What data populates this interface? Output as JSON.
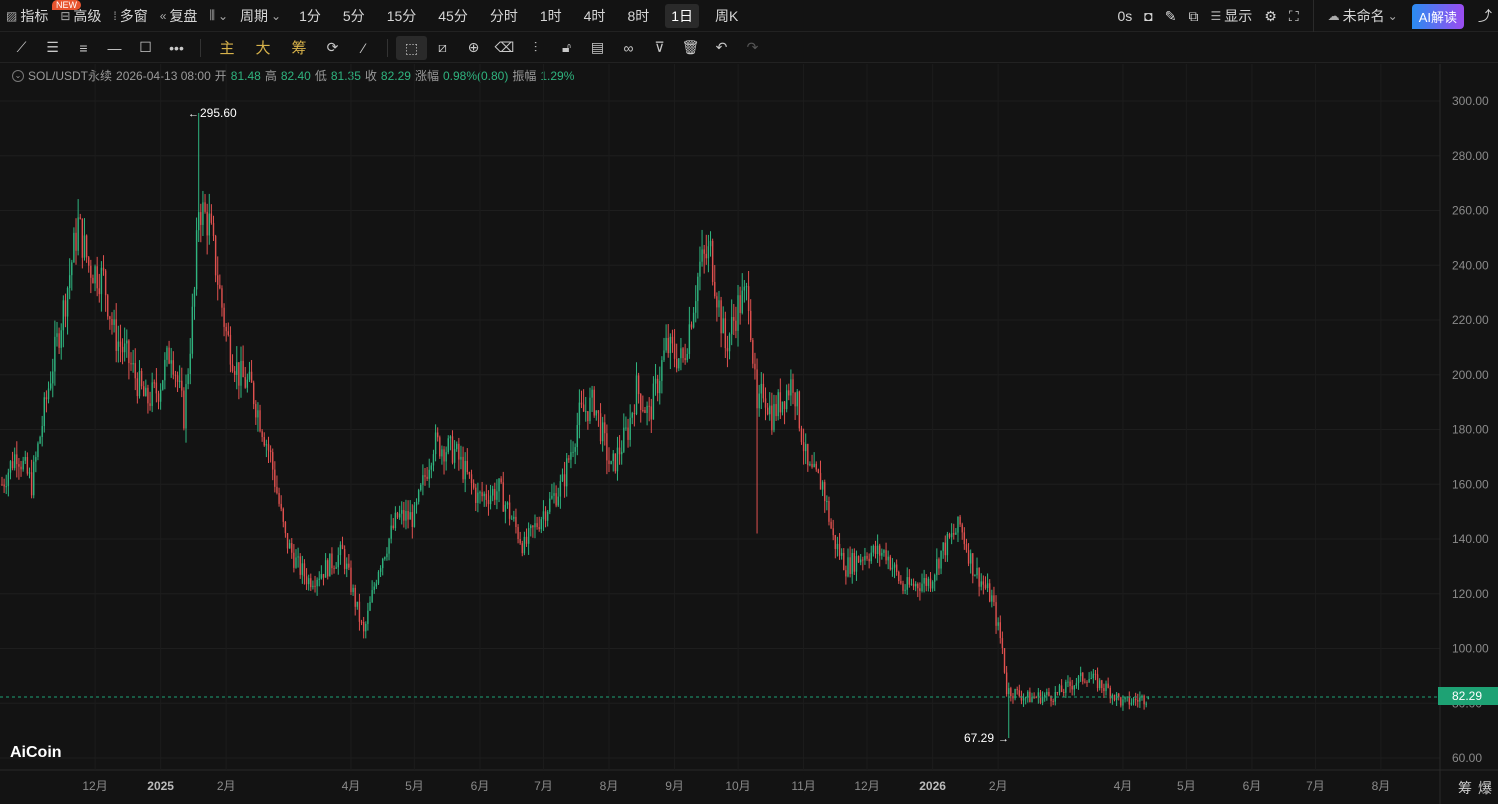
{
  "topbar": {
    "indicators": "指标",
    "new_badge": "NEW",
    "advanced": "高级",
    "multi": "多窗",
    "replay": "复盘",
    "period": "周期",
    "intervals": [
      "1分",
      "5分",
      "15分",
      "45分",
      "分时",
      "1时",
      "4时",
      "8时",
      "1日",
      "周K"
    ],
    "selected_interval": "1日",
    "countdown": "0s",
    "display": "显示",
    "layout_name": "未命名",
    "ai": "AI解读"
  },
  "toolbar": {
    "main": "主",
    "big": "大",
    "chips": "筹"
  },
  "info": {
    "symbol": "SOL/USDT永续",
    "datetime": "2026-04-13 08:00",
    "open_label": "开",
    "open": "81.48",
    "high_label": "高",
    "high": "82.40",
    "low_label": "低",
    "low": "81.35",
    "close_label": "收",
    "close": "82.29",
    "change_label": "涨幅",
    "change": "0.98%(0.80)",
    "amp_label": "振幅",
    "amp": "1.29%"
  },
  "colors": {
    "up": "#2fb47f",
    "down": "#e0514f",
    "bg": "#131313"
  },
  "logo": "AiCoin",
  "bottom": {
    "chips": "筹",
    "liq": "爆"
  },
  "chart_data": {
    "type": "candlestick",
    "symbol": "SOL/USDT",
    "interval": "1d",
    "ylim": [
      60,
      300
    ],
    "yticks": [
      "300.00",
      "280.00",
      "260.00",
      "240.00",
      "220.00",
      "200.00",
      "180.00",
      "160.00",
      "140.00",
      "120.00",
      "100.00",
      "80.00",
      "60.00"
    ],
    "xticks": [
      {
        "label": "12月",
        "date": "2024-12-01"
      },
      {
        "label": "2025",
        "date": "2025-01-01"
      },
      {
        "label": "2月",
        "date": "2025-02-01"
      },
      {
        "label": "4月",
        "date": "2025-04-01"
      },
      {
        "label": "5月",
        "date": "2025-05-01"
      },
      {
        "label": "6月",
        "date": "2025-06-01"
      },
      {
        "label": "7月",
        "date": "2025-07-01"
      },
      {
        "label": "8月",
        "date": "2025-08-01"
      },
      {
        "label": "9月",
        "date": "2025-09-01"
      },
      {
        "label": "10月",
        "date": "2025-10-01"
      },
      {
        "label": "11月",
        "date": "2025-11-01"
      },
      {
        "label": "12月",
        "date": "2025-12-01"
      },
      {
        "label": "2026",
        "date": "2026-01-01"
      },
      {
        "label": "2月",
        "date": "2026-02-01"
      },
      {
        "label": "4月",
        "date": "2026-04-01"
      },
      {
        "label": "5月",
        "date": "2026-05-01"
      },
      {
        "label": "6月",
        "date": "2026-06-01"
      },
      {
        "label": "7月",
        "date": "2026-07-01"
      },
      {
        "label": "8月",
        "date": "2026-08-01"
      }
    ],
    "max_label": "295.60",
    "min_label": "67.29",
    "last_price": "82.29",
    "last_price_value": 82.29,
    "close_keypoints": [
      [
        "2024-10-18",
        160
      ],
      [
        "2024-10-25",
        172
      ],
      [
        "2024-11-01",
        160
      ],
      [
        "2024-11-10",
        200
      ],
      [
        "2024-11-17",
        228
      ],
      [
        "2024-11-23",
        255
      ],
      [
        "2024-11-28",
        240
      ],
      [
        "2024-12-05",
        235
      ],
      [
        "2024-12-10",
        215
      ],
      [
        "2024-12-17",
        205
      ],
      [
        "2024-12-25",
        190
      ],
      [
        "2024-12-31",
        195
      ],
      [
        "2025-01-06",
        210
      ],
      [
        "2025-01-12",
        185
      ],
      [
        "2025-01-17",
        230
      ],
      [
        "2025-01-19",
        262
      ],
      [
        "2025-01-24",
        255
      ],
      [
        "2025-01-28",
        235
      ],
      [
        "2025-02-01",
        215
      ],
      [
        "2025-02-07",
        200
      ],
      [
        "2025-02-13",
        195
      ],
      [
        "2025-02-22",
        170
      ],
      [
        "2025-03-01",
        140
      ],
      [
        "2025-03-07",
        130
      ],
      [
        "2025-03-12",
        125
      ],
      [
        "2025-03-18",
        128
      ],
      [
        "2025-03-28",
        135
      ],
      [
        "2025-04-07",
        105
      ],
      [
        "2025-04-14",
        130
      ],
      [
        "2025-04-23",
        148
      ],
      [
        "2025-05-01",
        148
      ],
      [
        "2025-05-10",
        175
      ],
      [
        "2025-05-20",
        172
      ],
      [
        "2025-05-31",
        155
      ],
      [
        "2025-06-10",
        158
      ],
      [
        "2025-06-22",
        137
      ],
      [
        "2025-07-01",
        150
      ],
      [
        "2025-07-10",
        160
      ],
      [
        "2025-07-18",
        185
      ],
      [
        "2025-07-25",
        190
      ],
      [
        "2025-08-02",
        165
      ],
      [
        "2025-08-10",
        180
      ],
      [
        "2025-08-14",
        195
      ],
      [
        "2025-08-20",
        185
      ],
      [
        "2025-08-28",
        210
      ],
      [
        "2025-09-05",
        205
      ],
      [
        "2025-09-13",
        240
      ],
      [
        "2025-09-18",
        245
      ],
      [
        "2025-09-25",
        210
      ],
      [
        "2025-10-01",
        225
      ],
      [
        "2025-10-06",
        230
      ],
      [
        "2025-10-10",
        185
      ],
      [
        "2025-10-13",
        195
      ],
      [
        "2025-10-17",
        185
      ],
      [
        "2025-10-27",
        198
      ],
      [
        "2025-11-03",
        165
      ],
      [
        "2025-11-10",
        160
      ],
      [
        "2025-11-15",
        140
      ],
      [
        "2025-11-21",
        130
      ],
      [
        "2025-12-01",
        135
      ],
      [
        "2025-12-10",
        135
      ],
      [
        "2025-12-18",
        122
      ],
      [
        "2025-12-31",
        125
      ],
      [
        "2026-01-05",
        135
      ],
      [
        "2026-01-14",
        145
      ],
      [
        "2026-01-20",
        130
      ],
      [
        "2026-01-29",
        118
      ],
      [
        "2026-02-03",
        100
      ],
      [
        "2026-02-05",
        85
      ],
      [
        "2026-02-15",
        82
      ],
      [
        "2026-02-28",
        83
      ],
      [
        "2026-03-10",
        88
      ],
      [
        "2026-03-15",
        90
      ],
      [
        "2026-03-25",
        85
      ],
      [
        "2026-04-01",
        80
      ],
      [
        "2026-04-13",
        82.29
      ]
    ]
  }
}
